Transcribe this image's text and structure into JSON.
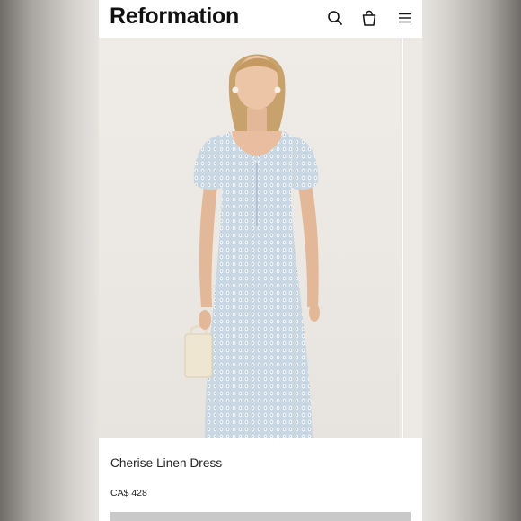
{
  "header": {
    "brand": "Reformation",
    "icons": [
      "search-icon",
      "shopping-bag-icon",
      "menu-icon"
    ]
  },
  "product": {
    "name": "Cherise Linen Dress",
    "price": "CA$ 428"
  },
  "colors": {
    "background": "#ffffff",
    "photo_bg": "#ece8e3",
    "dress": "#c9d7e3",
    "text": "#222222",
    "button": "#c9c9c9"
  }
}
